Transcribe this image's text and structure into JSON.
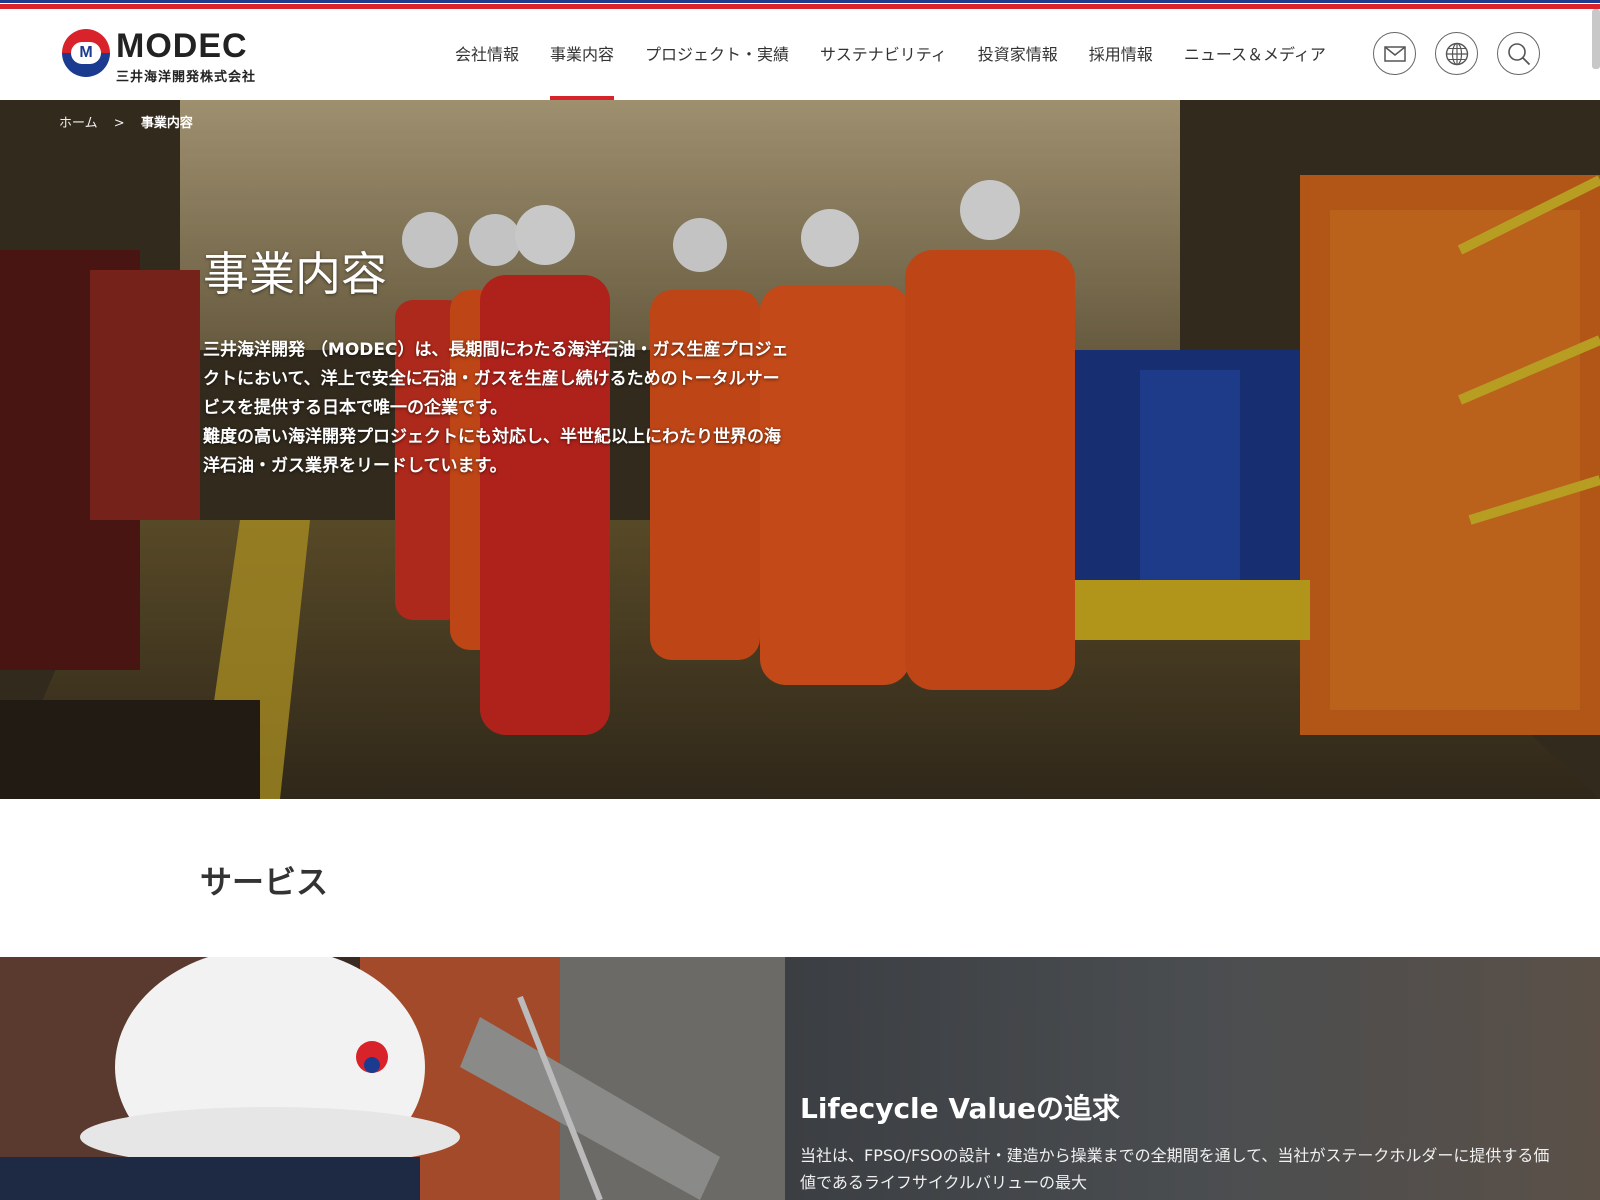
{
  "header": {
    "logo_word": "MODEC",
    "logo_letter": "M",
    "logo_sub": "三井海洋開発株式会社",
    "nav": [
      {
        "label": "会社情報"
      },
      {
        "label": "事業内容"
      },
      {
        "label": "プロジェクト・実績"
      },
      {
        "label": "サステナビリティ"
      },
      {
        "label": "投資家情報"
      },
      {
        "label": "採用情報"
      },
      {
        "label": "ニュース＆メディア"
      }
    ],
    "active_nav": "事業内容",
    "icons": [
      "mail-icon",
      "globe-icon",
      "search-icon"
    ]
  },
  "breadcrumb": {
    "home": "ホーム",
    "separator": ">",
    "current": "事業内容"
  },
  "hero": {
    "title": "事業内容",
    "text_1": "三井海洋開発 （MODEC）は、長期間にわたる海洋石油・ガス生産プロジェクトにおいて、洋上で安全に石油・ガスを生産し続けるためのトータルサービスを提供する日本で唯一の企業です。",
    "text_2": "難度の高い海洋開発プロジェクトにも対応し、半世紀以上にわたり世界の海洋石油・ガス業界をリードしています。"
  },
  "services": {
    "title": "サービス"
  },
  "lifecycle": {
    "title": "Lifecycle Valueの追求",
    "text": "当社は、FPSO/FSOの設計・建造から操業までの全期間を通して、当社がステークホルダーに提供する価値であるライフサイクルバリューの最大"
  },
  "colors": {
    "brand_red": "#d8232a",
    "brand_blue": "#1a3b8f",
    "coverall_orange": "#e8551c"
  }
}
